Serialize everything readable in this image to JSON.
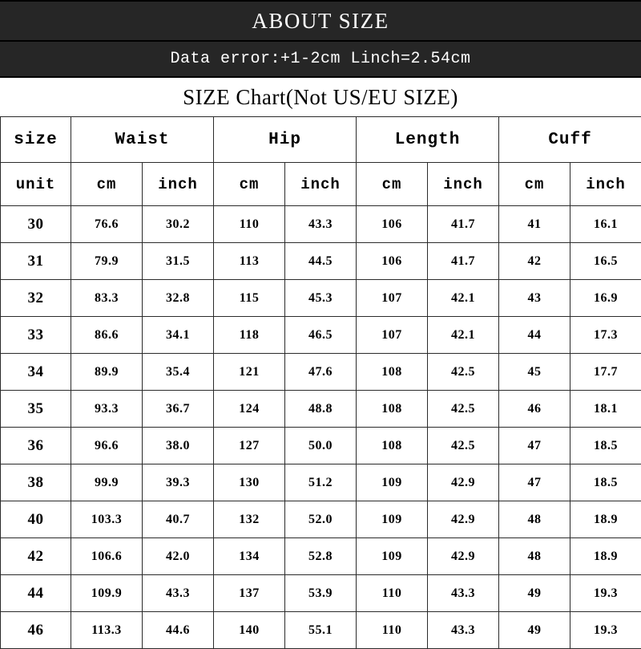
{
  "banner": {
    "title": "ABOUT SIZE",
    "note": "Data error:+1-2cm Linch=2.54cm"
  },
  "title_row": {
    "text": "SIZE Chart(Not US/EU SIZE)"
  },
  "colors": {
    "banner_bg": "#262626",
    "banner_text": "#ffffff",
    "measure_header": "#ee1111",
    "grid_line": "#2b2b2b",
    "page_bg": "#ffffff",
    "text": "#000000"
  },
  "table": {
    "size_header": "size",
    "unit_header": "unit",
    "measures": [
      "Waist",
      "Hip",
      "Length",
      "Cuff"
    ],
    "units": [
      "cm",
      "inch"
    ],
    "unit_row": [
      "cm",
      "inch",
      "cm",
      "inch",
      "cm",
      "inch",
      "cm",
      "inch"
    ],
    "rows": [
      {
        "size": "30",
        "cells": [
          "76.6",
          "30.2",
          "110",
          "43.3",
          "106",
          "41.7",
          "41",
          "16.1"
        ]
      },
      {
        "size": "31",
        "cells": [
          "79.9",
          "31.5",
          "113",
          "44.5",
          "106",
          "41.7",
          "42",
          "16.5"
        ]
      },
      {
        "size": "32",
        "cells": [
          "83.3",
          "32.8",
          "115",
          "45.3",
          "107",
          "42.1",
          "43",
          "16.9"
        ]
      },
      {
        "size": "33",
        "cells": [
          "86.6",
          "34.1",
          "118",
          "46.5",
          "107",
          "42.1",
          "44",
          "17.3"
        ]
      },
      {
        "size": "34",
        "cells": [
          "89.9",
          "35.4",
          "121",
          "47.6",
          "108",
          "42.5",
          "45",
          "17.7"
        ]
      },
      {
        "size": "35",
        "cells": [
          "93.3",
          "36.7",
          "124",
          "48.8",
          "108",
          "42.5",
          "46",
          "18.1"
        ]
      },
      {
        "size": "36",
        "cells": [
          "96.6",
          "38.0",
          "127",
          "50.0",
          "108",
          "42.5",
          "47",
          "18.5"
        ]
      },
      {
        "size": "38",
        "cells": [
          "99.9",
          "39.3",
          "130",
          "51.2",
          "109",
          "42.9",
          "47",
          "18.5"
        ]
      },
      {
        "size": "40",
        "cells": [
          "103.3",
          "40.7",
          "132",
          "52.0",
          "109",
          "42.9",
          "48",
          "18.9"
        ]
      },
      {
        "size": "42",
        "cells": [
          "106.6",
          "42.0",
          "134",
          "52.8",
          "109",
          "42.9",
          "48",
          "18.9"
        ]
      },
      {
        "size": "44",
        "cells": [
          "109.9",
          "43.3",
          "137",
          "53.9",
          "110",
          "43.3",
          "49",
          "19.3"
        ]
      },
      {
        "size": "46",
        "cells": [
          "113.3",
          "44.6",
          "140",
          "55.1",
          "110",
          "43.3",
          "49",
          "19.3"
        ]
      }
    ]
  }
}
